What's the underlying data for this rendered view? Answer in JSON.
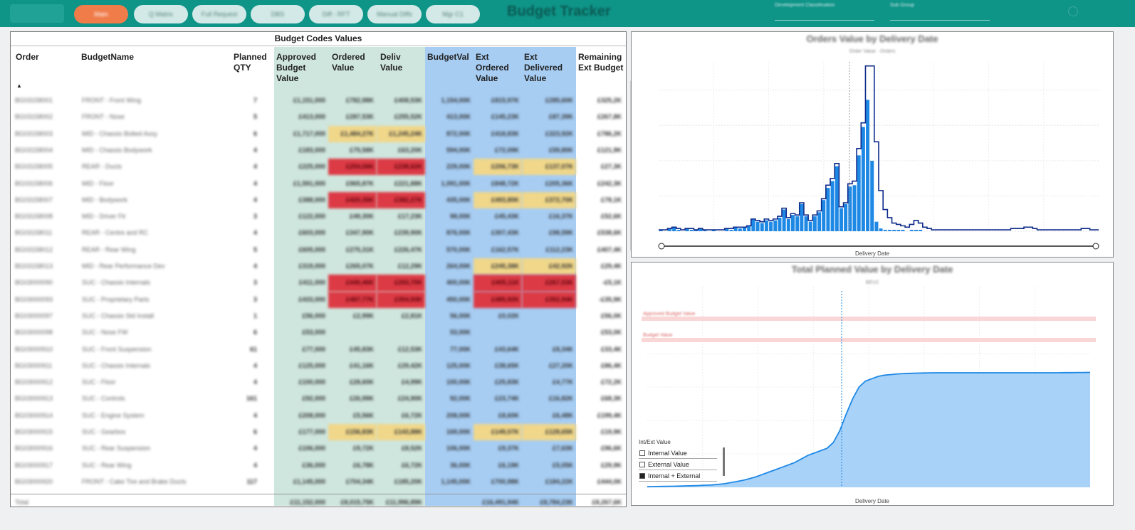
{
  "app": {
    "title": "Budget Tracker",
    "nav": [
      "Main",
      "Q Matrix",
      "Full Request",
      "DBS",
      "Diff - RFT",
      "Manual Diffs",
      "Mgr C1"
    ],
    "slicers": [
      "Development Classification",
      "Sub Group"
    ]
  },
  "table": {
    "title": "Budget Codes Values",
    "headers": {
      "order": "Order",
      "budget_name": "BudgetName",
      "planned_qty": "Planned QTY",
      "approved": "Approved Budget Value",
      "ordered": "Ordered Value",
      "deliv": "Deliv Value",
      "budgetval": "BudgetVal",
      "ext_ordered": "Ext Ordered Value",
      "ext_delivered": "Ext Delivered Value",
      "remaining": "Remaining Ext Budget"
    },
    "rows": [
      {
        "order": "BG03158001",
        "name": "FRONT - Front Wing",
        "qty": "7",
        "approved": "£1,151,000",
        "ordered": "£782,98K",
        "deliv": "£408,53K",
        "budgetval": "1,154,00K",
        "ext_ordered": "£815,97K",
        "ext_delivered": "£285,60K",
        "remaining": "£325,2K",
        "hl": {}
      },
      {
        "order": "BG03158002",
        "name": "FRONT - Nose",
        "qty": "5",
        "approved": "£413,000",
        "ordered": "£287,53K",
        "deliv": "£255,52K",
        "budgetval": "413,00K",
        "ext_ordered": "£145,23K",
        "ext_delivered": "£87,39K",
        "remaining": "£267,8K",
        "hl": {}
      },
      {
        "order": "BG03158003",
        "name": "MID - Chassis Bolted Assy",
        "qty": "6",
        "approved": "£1,717,000",
        "ordered": "£1,484,27K",
        "deliv": "£1,245,24K",
        "budgetval": "872,00K",
        "ext_ordered": "£418,83K",
        "ext_delivered": "£323,92K",
        "remaining": "£786,2K",
        "hl": {
          "ordered": "yel",
          "deliv": "yel"
        }
      },
      {
        "order": "BG03158004",
        "name": "MID - Chassis Bodywork",
        "qty": "4",
        "approved": "£183,000",
        "ordered": "£75,58K",
        "deliv": "£63,20K",
        "budgetval": "594,00K",
        "ext_ordered": "£72,09K",
        "ext_delivered": "£59,80K",
        "remaining": "£121,9K",
        "hl": {}
      },
      {
        "order": "BG03158005",
        "name": "REAR - Ducts",
        "qty": "4",
        "approved": "£225,000",
        "ordered": "£254,06K",
        "deliv": "£238,62K",
        "budgetval": "229,00K",
        "ext_ordered": "£206,73K",
        "ext_delivered": "£137,07K",
        "remaining": "£27,3K",
        "hl": {
          "ordered": "red",
          "deliv": "red",
          "ext_ordered": "yel",
          "ext_delivered": "yel"
        }
      },
      {
        "order": "BG03158006",
        "name": "MID - Floor",
        "qty": "4",
        "approved": "£1,591,000",
        "ordered": "£965,87K",
        "deliv": "£221,88K",
        "budgetval": "1,091,00K",
        "ext_ordered": "£848,72K",
        "ext_delivered": "£205,36K",
        "remaining": "£242,3K",
        "hl": {}
      },
      {
        "order": "BG03158007",
        "name": "MID - Bodywork",
        "qty": "4",
        "approved": "£388,000",
        "ordered": "£420,35K",
        "deliv": "£382,27K",
        "budgetval": "435,00K",
        "ext_ordered": "£493,80K",
        "ext_delivered": "£372,70K",
        "remaining": "£78,1K",
        "hl": {
          "ordered": "red",
          "deliv": "red",
          "ext_ordered": "yel",
          "ext_delivered": "yel"
        }
      },
      {
        "order": "BG03158008",
        "name": "MID - Driver Fit",
        "qty": "3",
        "approved": "£122,000",
        "ordered": "£49,30K",
        "deliv": "£17,23K",
        "budgetval": "98,00K",
        "ext_ordered": "£45,43K",
        "ext_delivered": "£16,37K",
        "remaining": "£52,6K",
        "hl": {}
      },
      {
        "order": "BG03158011",
        "name": "REAR - Centre and RC",
        "qty": "4",
        "approved": "£603,000",
        "ordered": "£347,90K",
        "deliv": "£239,90K",
        "budgetval": "876,00K",
        "ext_ordered": "£307,43K",
        "ext_delivered": "£98,59K",
        "remaining": "£538,6K",
        "hl": {}
      },
      {
        "order": "BG03158012",
        "name": "REAR - Rear Wing",
        "qty": "5",
        "approved": "£605,000",
        "ordered": "£275,31K",
        "deliv": "£226,47K",
        "budgetval": "570,00K",
        "ext_ordered": "£162,57K",
        "ext_delivered": "£112,23K",
        "remaining": "£407,4K",
        "hl": {}
      },
      {
        "order": "BG03158013",
        "name": "MID - Rear Performance Dev",
        "qty": "4",
        "approved": "£319,000",
        "ordered": "£265,07K",
        "deliv": "£12,29K",
        "budgetval": "264,00K",
        "ext_ordered": "£245,38K",
        "ext_delivered": "£42,92K",
        "remaining": "£29,4K",
        "hl": {
          "ext_ordered": "yel",
          "ext_delivered": "yel"
        }
      },
      {
        "order": "BG03000090",
        "name": "SUC - Chassis Internals",
        "qty": "3",
        "approved": "£411,000",
        "ordered": "£440,46K",
        "deliv": "£293,70K",
        "budgetval": "400,00K",
        "ext_ordered": "£405,11K",
        "ext_delivered": "£267,53K",
        "remaining": "-£5,1K",
        "hl": {
          "ordered": "red",
          "deliv": "red",
          "ext_ordered": "red",
          "ext_delivered": "red"
        }
      },
      {
        "order": "BG03000093",
        "name": "SUC - Proprietary Parts",
        "qty": "3",
        "approved": "£433,000",
        "ordered": "£487,77K",
        "deliv": "£354,93K",
        "budgetval": "450,00K",
        "ext_ordered": "£485,92K",
        "ext_delivered": "£352,94K",
        "remaining": "-£35,9K",
        "hl": {
          "ordered": "red",
          "deliv": "red",
          "ext_ordered": "red",
          "ext_delivered": "red"
        }
      },
      {
        "order": "BG03000097",
        "name": "SUC - Chassis Std Install",
        "qty": "1",
        "approved": "£56,000",
        "ordered": "£2,99K",
        "deliv": "£2,81K",
        "budgetval": "56,00K",
        "ext_ordered": "£0,02K",
        "ext_delivered": "",
        "remaining": "£56,0K",
        "hl": {}
      },
      {
        "order": "BG03000098",
        "name": "SUC - Nose FW",
        "qty": "6",
        "approved": "£53,000",
        "ordered": "",
        "deliv": "",
        "budgetval": "53,00K",
        "ext_ordered": "",
        "ext_delivered": "",
        "remaining": "£53,0K",
        "hl": {}
      },
      {
        "order": "BG03000910",
        "name": "SUC - Front Suspension",
        "qty": "61",
        "approved": "£77,000",
        "ordered": "£45,83K",
        "deliv": "£12,53K",
        "budgetval": "77,00K",
        "ext_ordered": "£43,64K",
        "ext_delivered": "£8,34K",
        "remaining": "£33,4K",
        "hl": {}
      },
      {
        "order": "BG03000911",
        "name": "SUC - Chassis Internals",
        "qty": "4",
        "approved": "£125,000",
        "ordered": "£41,16K",
        "deliv": "£29,42K",
        "budgetval": "125,00K",
        "ext_ordered": "£38,65K",
        "ext_delivered": "£27,20K",
        "remaining": "£86,4K",
        "hl": {}
      },
      {
        "order": "BG03000912",
        "name": "SUC - Floor",
        "qty": "4",
        "approved": "£100,000",
        "ordered": "£28,60K",
        "deliv": "£4,99K",
        "budgetval": "100,00K",
        "ext_ordered": "£25,83K",
        "ext_delivered": "£4,77K",
        "remaining": "£72,2K",
        "hl": {}
      },
      {
        "order": "BG03000913",
        "name": "SUC - Controls",
        "qty": "161",
        "approved": "£92,000",
        "ordered": "£26,99K",
        "deliv": "£24,90K",
        "budgetval": "92,00K",
        "ext_ordered": "£23,74K",
        "ext_delivered": "£16,82K",
        "remaining": "£68,3K",
        "hl": {}
      },
      {
        "order": "BG03000914",
        "name": "SUC - Engine System",
        "qty": "4",
        "approved": "£208,000",
        "ordered": "£5,56K",
        "deliv": "£6,72K",
        "budgetval": "208,00K",
        "ext_ordered": "£8,60K",
        "ext_delivered": "£6,48K",
        "remaining": "£199,4K",
        "hl": {}
      },
      {
        "order": "BG03000915",
        "name": "SUC - Gearbox",
        "qty": "6",
        "approved": "£177,000",
        "ordered": "£156,83K",
        "deliv": "£143,88K",
        "budgetval": "169,00K",
        "ext_ordered": "£149,07K",
        "ext_delivered": "£128,65K",
        "remaining": "£19,9K",
        "hl": {
          "ordered": "yel",
          "deliv": "yel",
          "ext_ordered": "yel",
          "ext_delivered": "yel"
        }
      },
      {
        "order": "BG03000916",
        "name": "SUC - Rear Suspension",
        "qty": "4",
        "approved": "£106,000",
        "ordered": "£9,72K",
        "deliv": "£8,52K",
        "budgetval": "106,00K",
        "ext_ordered": "£9,37K",
        "ext_delivered": "£7,63K",
        "remaining": "£96,6K",
        "hl": {}
      },
      {
        "order": "BG03000917",
        "name": "SUC - Rear Wing",
        "qty": "4",
        "approved": "£36,000",
        "ordered": "£6,78K",
        "deliv": "£6,72K",
        "budgetval": "36,00K",
        "ext_ordered": "£6,19K",
        "ext_delivered": "£5,05K",
        "remaining": "£29,9K",
        "hl": {}
      },
      {
        "order": "BG03000920",
        "name": "FRONT - Cake Tire and Brake Ducts",
        "qty": "117",
        "approved": "£1,145,000",
        "ordered": "£704,34K",
        "deliv": "£185,20K",
        "budgetval": "1,145,00K",
        "ext_ordered": "£700,98K",
        "ext_delivered": "£184,22K",
        "remaining": "£444,0K",
        "hl": {}
      }
    ],
    "total": {
      "label": "Total",
      "approved": "£11,152,000",
      "ordered": "£8,015,75K",
      "deliv": "£11,996,89K",
      "ext_ordered": "£16,491,94K",
      "ext_delivered": "£8,784,23K",
      "remaining": "£8,267,6K"
    },
    "colors": {
      "approved_bg": "#cfe6de",
      "budgetval_bg": "#a7cdf3",
      "red": "#dc3a45",
      "yellow": "#f0d78a"
    }
  },
  "chart1": {
    "title": "Orders Value by Delivery Date",
    "legend": "Order Value · Orders",
    "xlabel": "Delivery Date",
    "slider": "date-range-slider",
    "chart_data": {
      "type": "bar",
      "series": [
        {
          "name": "Order Value",
          "color": "#1e88e5",
          "values": [
            1,
            0,
            2,
            3,
            1,
            0,
            2,
            1,
            1,
            2,
            1,
            0,
            1,
            0,
            0,
            2,
            1,
            3,
            2,
            3,
            4,
            9,
            7,
            6,
            8,
            7,
            8,
            10,
            16,
            9,
            12,
            11,
            20,
            11,
            7,
            11,
            14,
            23,
            32,
            37,
            48,
            17,
            20,
            33,
            34,
            56,
            77,
            97,
            52,
            7,
            2,
            1,
            1,
            1,
            1,
            1,
            0,
            1,
            1,
            1,
            0,
            0,
            0,
            0,
            0,
            0,
            0,
            0,
            0,
            0,
            0,
            0,
            0,
            0,
            0,
            0,
            0,
            0,
            0,
            0,
            0,
            0,
            0,
            0,
            0,
            0,
            0,
            0,
            0,
            0,
            0,
            0,
            0,
            0,
            0,
            0,
            0,
            0,
            0,
            0
          ]
        },
        {
          "name": "Orders",
          "color": "#0d2a8a",
          "values": [
            1,
            1,
            2,
            3,
            2,
            1,
            2,
            2,
            1,
            2,
            1,
            1,
            1,
            1,
            1,
            2,
            2,
            3,
            3,
            3,
            4,
            9,
            8,
            7,
            9,
            8,
            9,
            11,
            17,
            10,
            13,
            12,
            21,
            12,
            8,
            12,
            15,
            24,
            34,
            39,
            50,
            18,
            21,
            35,
            37,
            61,
            80,
            122,
            122,
            66,
            30,
            16,
            10,
            6,
            5,
            4,
            3,
            5,
            8,
            6,
            3,
            2,
            1,
            1,
            1,
            1,
            1,
            1,
            1,
            1,
            1,
            1,
            1,
            1,
            1,
            1,
            1,
            1,
            1,
            1,
            2,
            2,
            2,
            3,
            3,
            2,
            1,
            1,
            1,
            1,
            1,
            1,
            1,
            1,
            1,
            1,
            2,
            2,
            1,
            1
          ]
        }
      ],
      "ylim": [
        0,
        125
      ],
      "grid": true
    }
  },
  "chart2": {
    "title": "Total Planned Value by Delivery Date",
    "legend": "BEV2",
    "xlabel": "Delivery Date",
    "ref_lines": [
      "Approved Budget Value",
      "Budget Value"
    ],
    "legend_box": {
      "title": "Int/Ext Value",
      "items": [
        {
          "label": "Internal Value",
          "checked": false
        },
        {
          "label": "External Value",
          "checked": false
        },
        {
          "label": "Internal + External",
          "checked": true
        }
      ]
    },
    "chart_data": {
      "type": "area",
      "color": "#1e88e5",
      "fill": "#a8d2f8",
      "values": [
        0.5,
        0.6,
        0.7,
        0.8,
        0.9,
        1.0,
        1.2,
        1.3,
        1.5,
        1.8,
        2,
        2.5,
        3,
        4,
        5,
        6,
        7.5,
        9,
        11,
        13,
        15,
        17,
        19,
        21,
        24,
        27,
        29,
        31,
        33,
        38,
        48,
        62,
        75,
        85,
        90,
        92,
        94,
        95,
        95.5,
        96,
        96.3,
        96.5,
        96.7,
        96.8,
        96.9,
        97,
        97,
        97,
        97,
        97,
        97,
        97,
        97,
        97,
        97,
        97,
        97,
        97,
        97,
        97,
        97,
        97,
        97,
        97,
        97,
        97.1,
        97.1,
        97.2,
        97.2,
        97.3
      ],
      "ylim": [
        0,
        100
      ],
      "grid": true
    }
  }
}
